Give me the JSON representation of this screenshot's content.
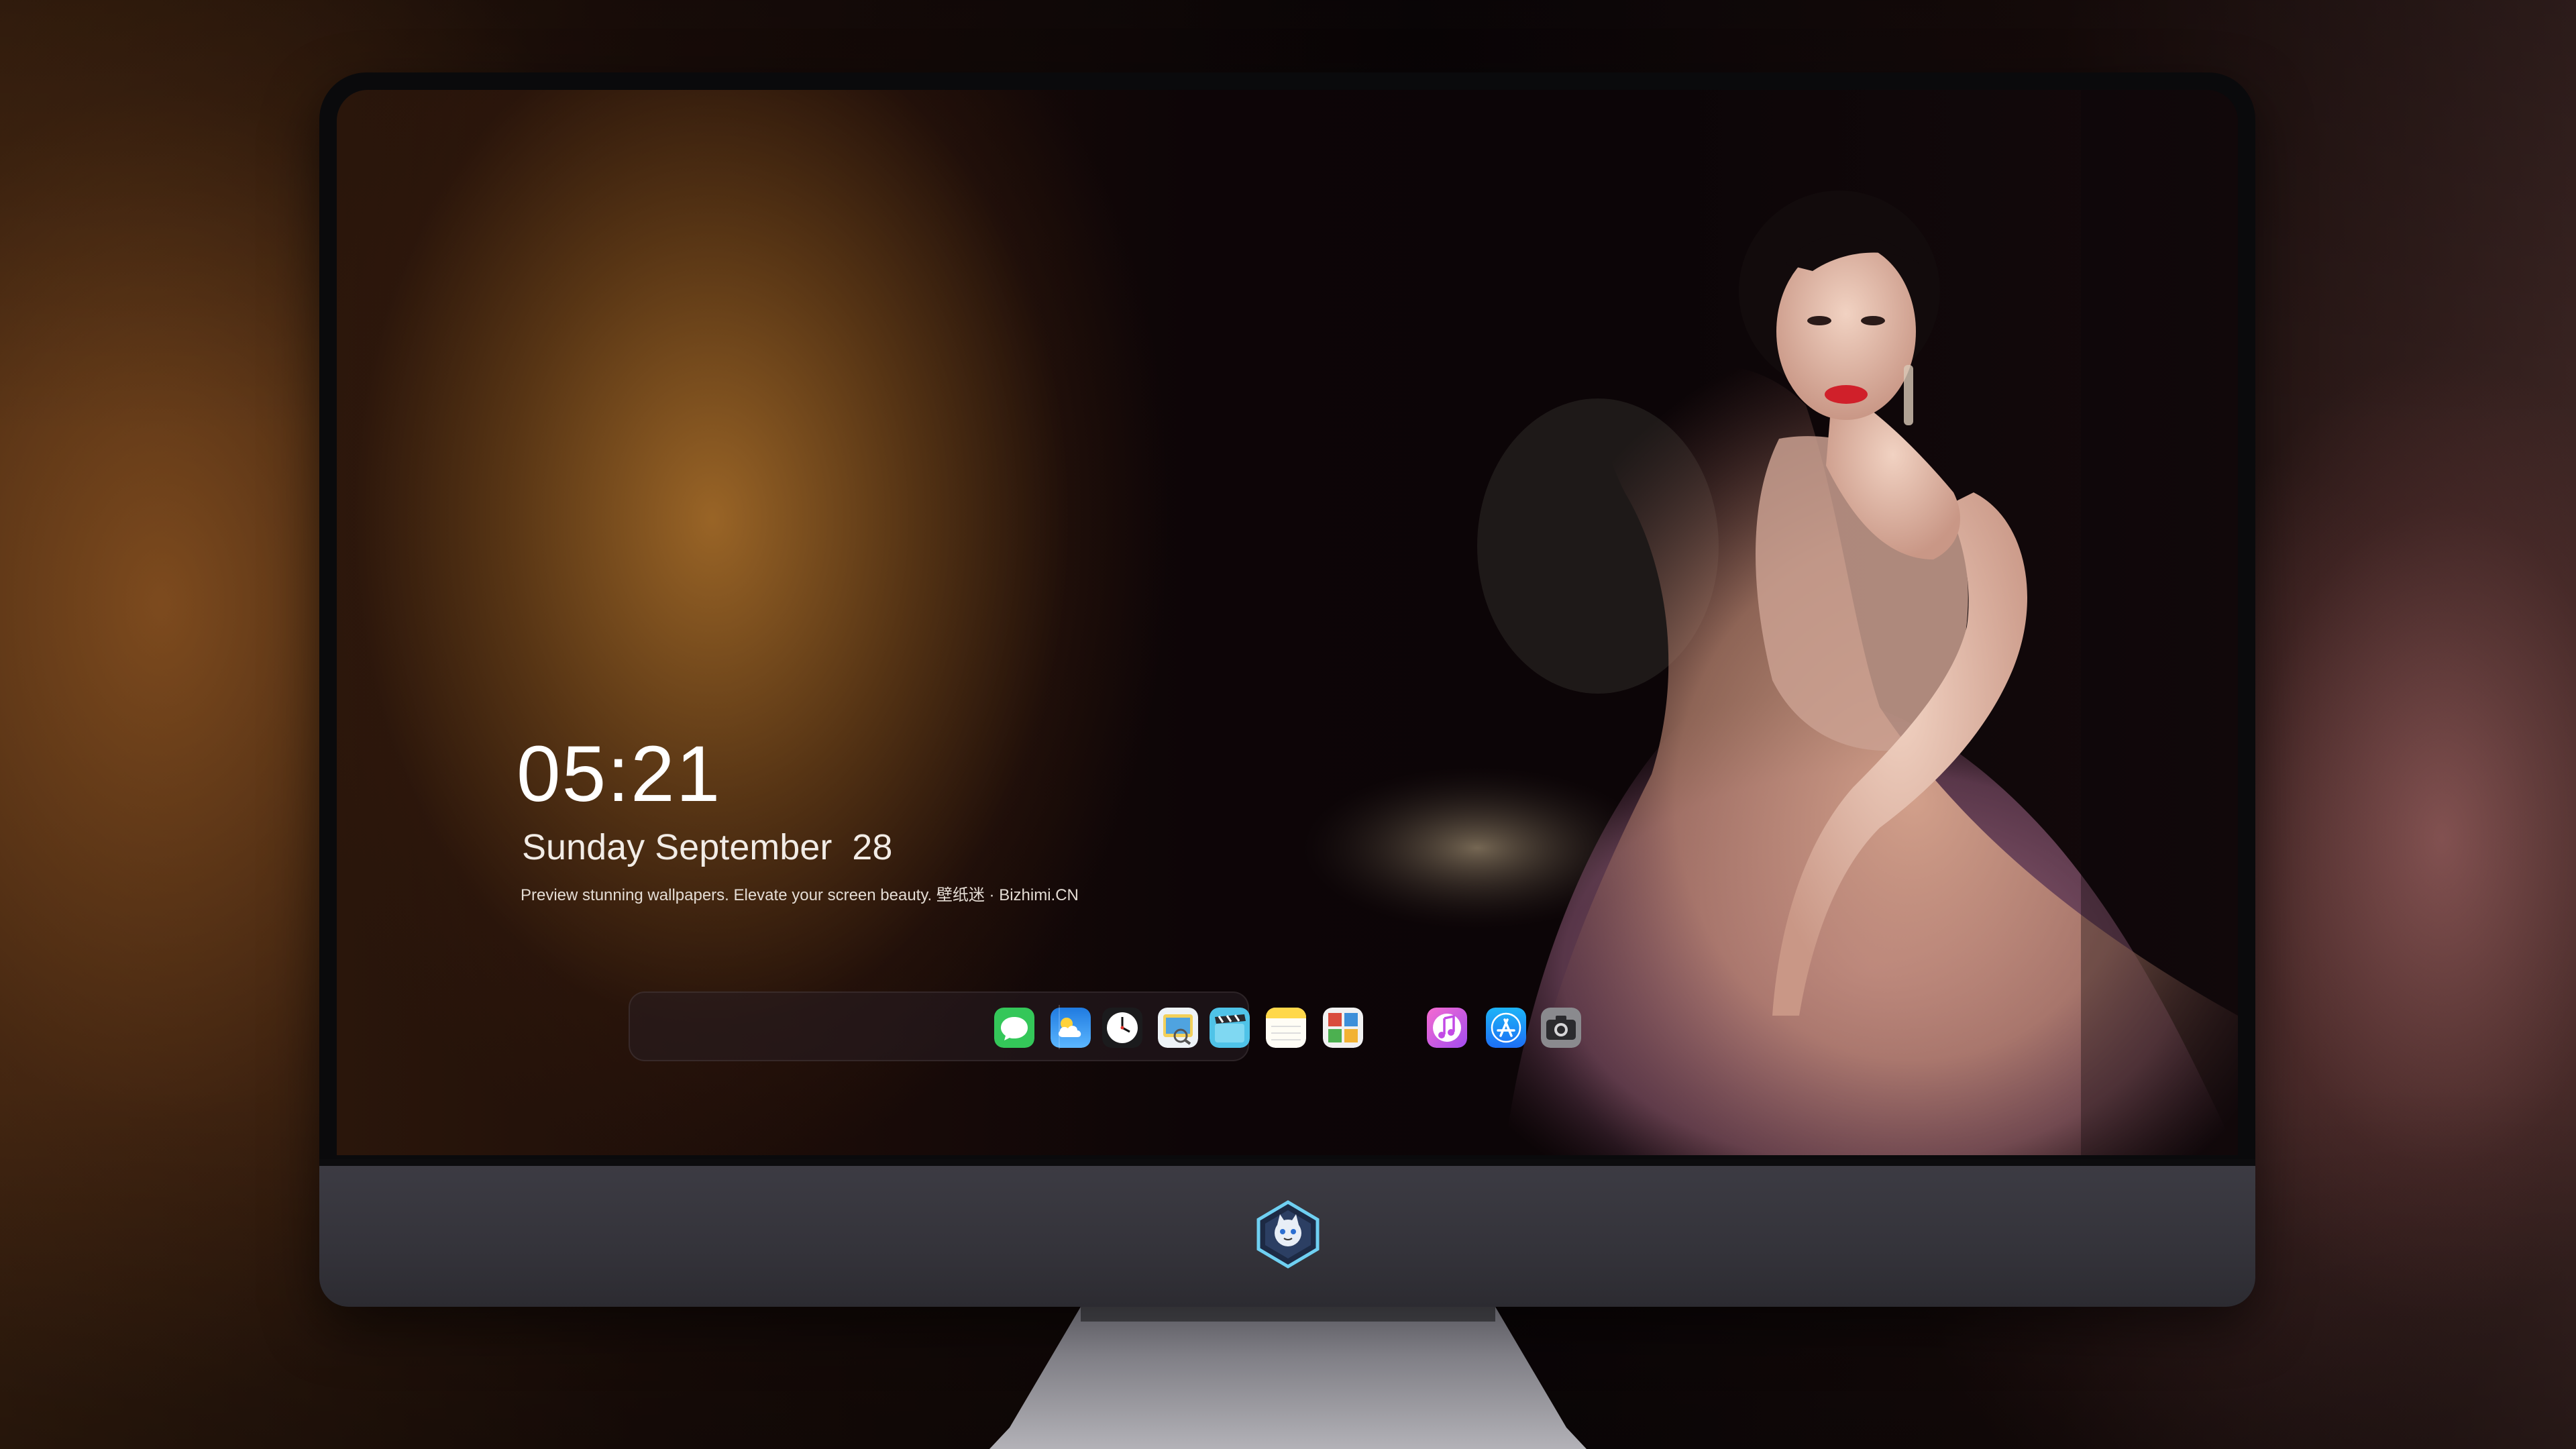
{
  "lockscreen": {
    "time": "05:21",
    "date": "Sunday September  28",
    "tagline": "Preview stunning wallpapers. Elevate your screen beauty. 壁纸迷 · Bizhimi.CN"
  },
  "dock": {
    "apps": [
      {
        "icon": "messages-icon",
        "color": "#34c759"
      },
      {
        "icon": "weather-icon",
        "color": "#2b8cf2"
      },
      {
        "icon": "clock-icon",
        "color": "#ffffff"
      },
      {
        "icon": "preview-icon",
        "color": "#f3d05a"
      },
      {
        "icon": "clips-icon",
        "color": "#4fc3e8"
      },
      {
        "icon": "notes-icon",
        "color": "#ffd84a"
      },
      {
        "icon": "photo-booth-icon",
        "color": "#d94c3d"
      },
      {
        "icon": "music-icon",
        "color": "#f25fbe"
      },
      {
        "icon": "app-store-icon",
        "color": "#1d8ff5"
      },
      {
        "icon": "camera-icon",
        "color": "#8a8a8e"
      }
    ]
  },
  "colors": {
    "screen_accent": "#a0692a",
    "dress_tone": "#c79080",
    "lip": "#d0202a"
  }
}
